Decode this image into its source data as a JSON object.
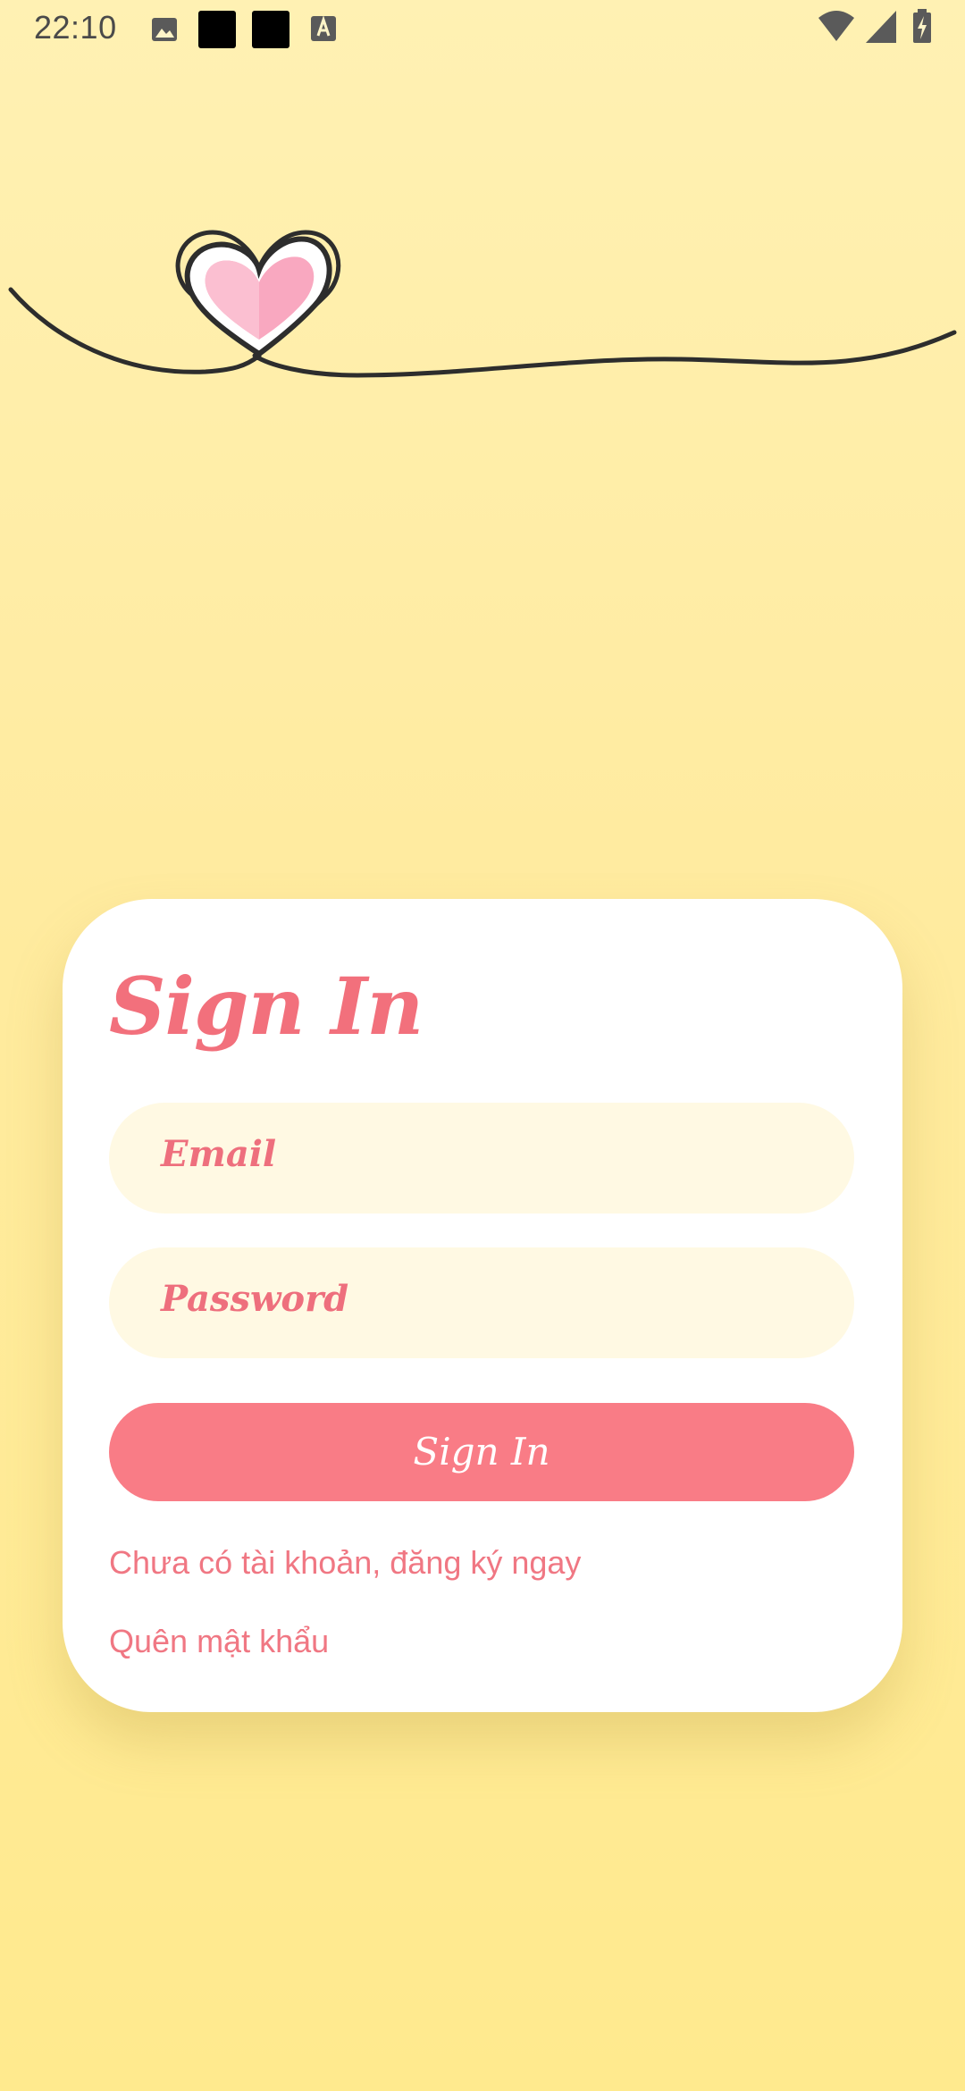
{
  "status_bar": {
    "time": "22:10",
    "icons_left": [
      "image-icon",
      "black-square-icon",
      "black-square-icon",
      "font-a-icon"
    ],
    "icons_right": [
      "wifi-icon",
      "signal-icon",
      "battery-charging-icon"
    ]
  },
  "colors": {
    "accent": "#f97c86",
    "field_bg": "#fff9e3",
    "background": "#ffeba0",
    "card": "#ffffff"
  },
  "signin": {
    "title": "Sign In",
    "email_placeholder": "Email",
    "password_placeholder": "Password",
    "button_label": "Sign In",
    "signup_link": "Chưa có tài khoản, đăng ký ngay",
    "forgot_link": "Quên mật khẩu"
  }
}
